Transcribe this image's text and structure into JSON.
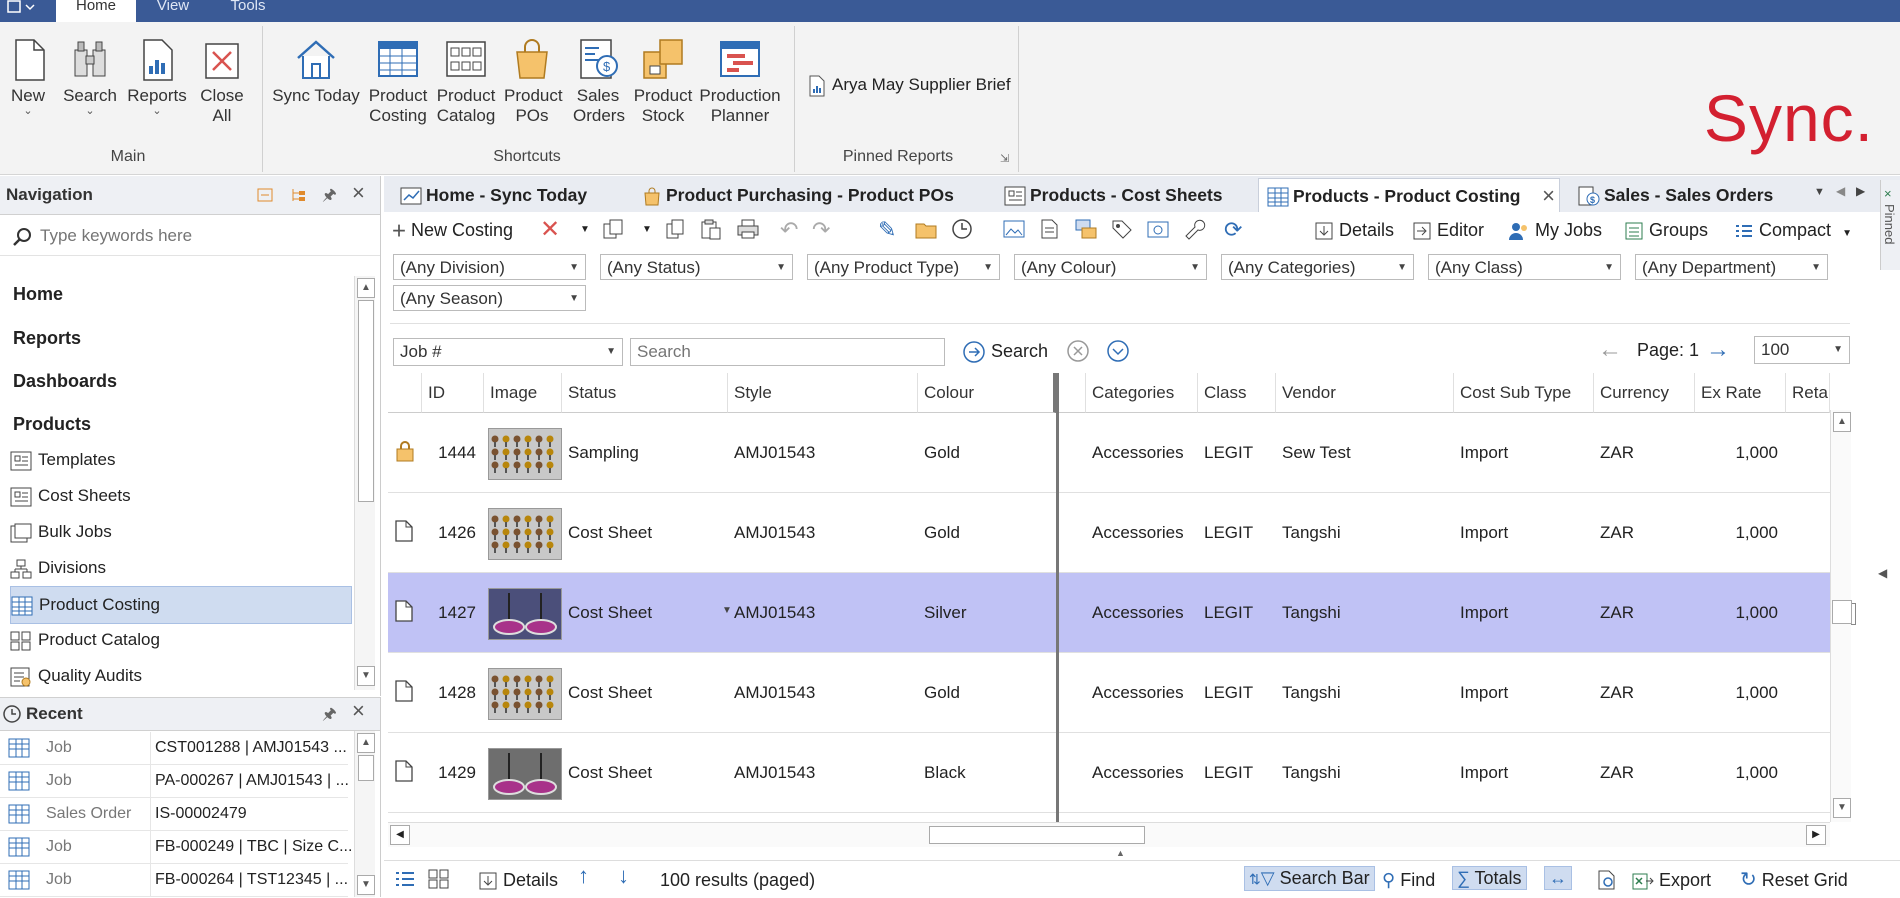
{
  "ribbon_tabs": [
    "Home",
    "View",
    "Tools"
  ],
  "ribbon": {
    "main_buttons": [
      {
        "label": "New",
        "has_dropdown": true,
        "icon": "document-icon"
      },
      {
        "label": "Search",
        "has_dropdown": true,
        "icon": "binoculars-icon"
      },
      {
        "label": "Reports",
        "has_dropdown": true,
        "icon": "report-icon"
      },
      {
        "label": "Close All",
        "has_dropdown": false,
        "icon": "close-all-icon"
      }
    ],
    "main_group_label": "Main",
    "shortcut_buttons": [
      {
        "label": "Sync Today",
        "icon": "home-icon"
      },
      {
        "label": "Product Costing",
        "icon": "costing-grid-icon"
      },
      {
        "label": "Product Catalog",
        "icon": "catalog-icon"
      },
      {
        "label": "Product POs",
        "icon": "shopping-bag-icon"
      },
      {
        "label": "Sales Orders",
        "icon": "sales-order-icon"
      },
      {
        "label": "Product Stock",
        "icon": "stock-boxes-icon"
      },
      {
        "label": "Production Planner",
        "icon": "planner-icon"
      }
    ],
    "shortcuts_group_label": "Shortcuts",
    "pinned_report": "Arya May Supplier Brief",
    "pinned_group_label": "Pinned Reports",
    "logo_text": "Sync."
  },
  "navigation": {
    "title": "Navigation",
    "search_placeholder": "Type keywords here",
    "headings": [
      "Home",
      "Reports",
      "Dashboards",
      "Products"
    ],
    "items": [
      {
        "label": "Templates",
        "selected": false
      },
      {
        "label": "Cost Sheets",
        "selected": false
      },
      {
        "label": "Bulk Jobs",
        "selected": false
      },
      {
        "label": "Divisions",
        "selected": false
      },
      {
        "label": "Product Costing",
        "selected": true
      },
      {
        "label": "Product Catalog",
        "selected": false
      },
      {
        "label": "Quality Audits",
        "selected": false
      }
    ]
  },
  "recent": {
    "title": "Recent",
    "rows": [
      {
        "type": "Job",
        "ref": "CST001288 | AMJ01543 ..."
      },
      {
        "type": "Job",
        "ref": "PA-000267 | AMJ01543 | ..."
      },
      {
        "type": "Sales Order",
        "ref": "IS-00002479"
      },
      {
        "type": "Job",
        "ref": "FB-000249 | TBC | Size C..."
      },
      {
        "type": "Job",
        "ref": "FB-000264 | TST12345 | ..."
      }
    ]
  },
  "doc_tabs": [
    {
      "label": "Home - Sync Today",
      "active": false
    },
    {
      "label": "Product Purchasing - Product POs",
      "active": false
    },
    {
      "label": "Products - Cost Sheets",
      "active": false
    },
    {
      "label": "Products - Product Costing",
      "active": true
    },
    {
      "label": "Sales - Sales Orders",
      "active": false
    }
  ],
  "toolbar": {
    "new_costing": "New Costing",
    "details": "Details",
    "editor": "Editor",
    "my_jobs": "My Jobs",
    "groups": "Groups",
    "compact": "Compact"
  },
  "filters": [
    "(Any Division)",
    "(Any Status)",
    "(Any Product Type)",
    "(Any Colour)",
    "(Any Categories)",
    "(Any Class)",
    "(Any Department)",
    "(Any Season)"
  ],
  "search_bar": {
    "field": "Job #",
    "placeholder": "Search",
    "button": "Search",
    "page_label": "Page: 1",
    "page_size": "100"
  },
  "grid": {
    "columns": [
      "ID",
      "Image",
      "Status",
      "Style",
      "Colour",
      "Categories",
      "Class",
      "Vendor",
      "Cost Sub Type",
      "Currency",
      "Ex Rate",
      "Retail P"
    ],
    "rows": [
      {
        "icon": "lock-icon",
        "id": "1444",
        "image": "jewelry-set-swatch",
        "status": "Sampling",
        "style": "AMJ01543",
        "colour": "Gold",
        "categories": "Accessories",
        "class": "LEGIT",
        "vendor": "Sew Test",
        "cost_sub_type": "Import",
        "currency": "ZAR",
        "ex_rate": "1,000",
        "selected": false
      },
      {
        "icon": "document-icon",
        "id": "1426",
        "image": "jewelry-set-swatch",
        "status": "Cost Sheet",
        "style": "AMJ01543",
        "colour": "Gold",
        "categories": "Accessories",
        "class": "LEGIT",
        "vendor": "Tangshi",
        "cost_sub_type": "Import",
        "currency": "ZAR",
        "ex_rate": "1,000",
        "selected": false
      },
      {
        "icon": "document-icon",
        "id": "1427",
        "image": "earring-pair-swatch",
        "status": "Cost Sheet",
        "style": "AMJ01543",
        "colour": "Silver",
        "categories": "Accessories",
        "class": "LEGIT",
        "vendor": "Tangshi",
        "cost_sub_type": "Import",
        "currency": "ZAR",
        "ex_rate": "1,000",
        "selected": true
      },
      {
        "icon": "document-icon",
        "id": "1428",
        "image": "jewelry-set-swatch",
        "status": "Cost Sheet",
        "style": "AMJ01543",
        "colour": "Gold",
        "categories": "Accessories",
        "class": "LEGIT",
        "vendor": "Tangshi",
        "cost_sub_type": "Import",
        "currency": "ZAR",
        "ex_rate": "1,000",
        "selected": false
      },
      {
        "icon": "document-icon",
        "id": "1429",
        "image": "earring-pair-swatch",
        "status": "Cost Sheet",
        "style": "AMJ01543",
        "colour": "Black",
        "categories": "Accessories",
        "class": "LEGIT",
        "vendor": "Tangshi",
        "cost_sub_type": "Import",
        "currency": "ZAR",
        "ex_rate": "1,000",
        "selected": false
      }
    ]
  },
  "bottom_bar": {
    "details": "Details",
    "results": "100 results (paged)",
    "search_bar": "Search Bar",
    "find": "Find",
    "totals": "Totals",
    "export": "Export",
    "reset_grid": "Reset Grid"
  },
  "right_edge_label": "Pinned",
  "colors": {
    "accent": "#3a5a96",
    "selection": "#c0c2f5",
    "nav_selected": "#cfdcf0",
    "logo": "#d32030",
    "icon_blue": "#2f6db5"
  }
}
